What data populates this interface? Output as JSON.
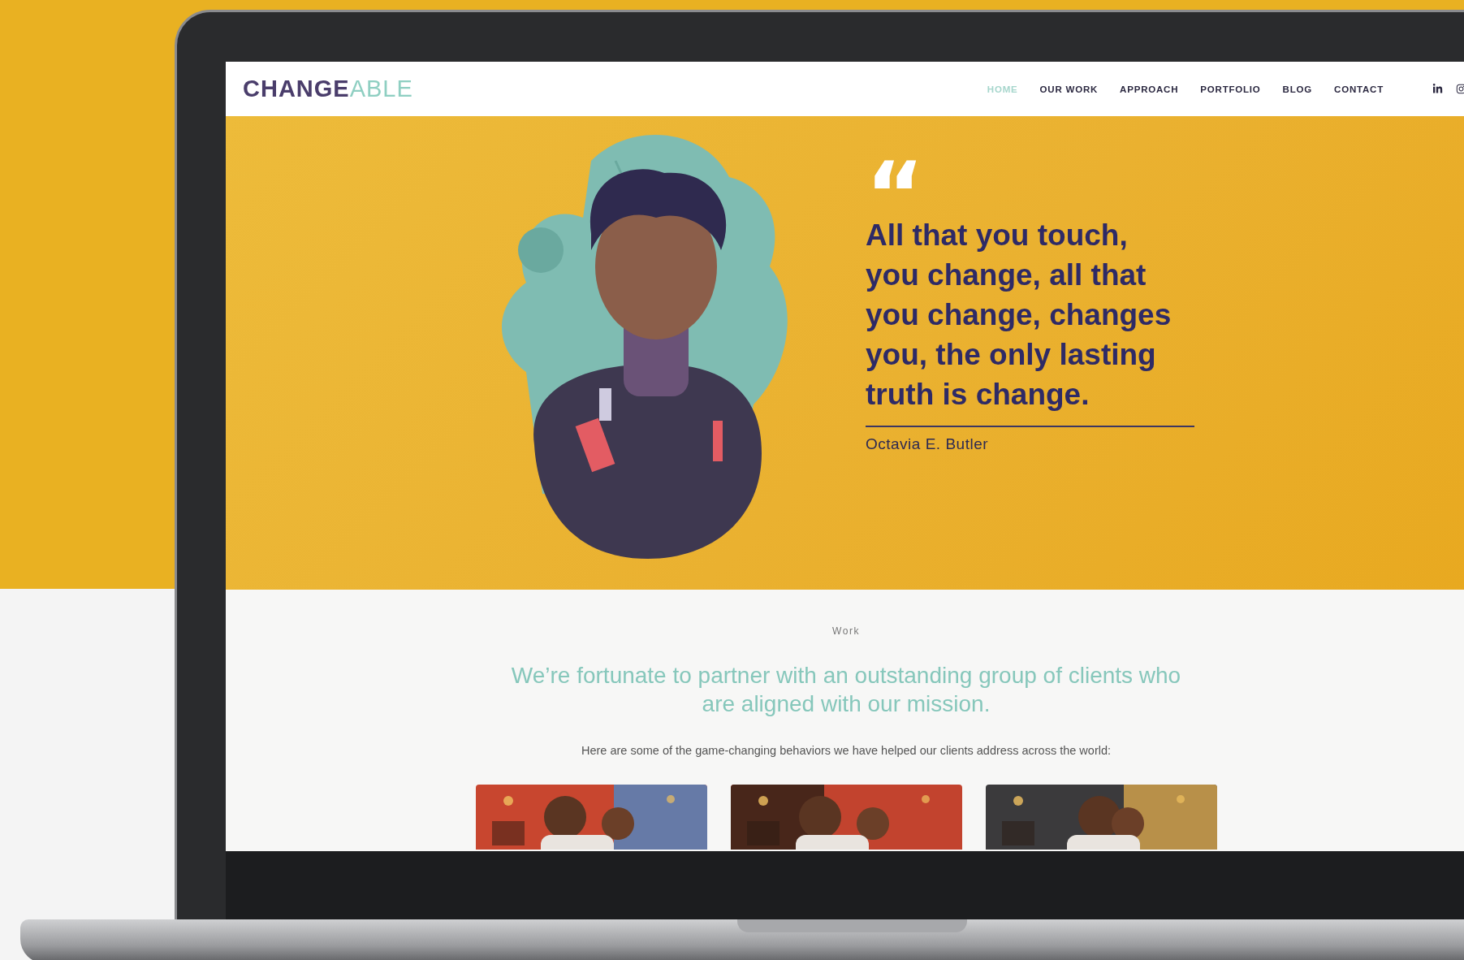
{
  "site": {
    "logo": {
      "first": "CHANGE",
      "second": "ABLE"
    },
    "nav": [
      {
        "label": "HOME",
        "selected": true
      },
      {
        "label": "OUR WORK",
        "selected": false
      },
      {
        "label": "APPROACH",
        "selected": false
      },
      {
        "label": "PORTFOLIO",
        "selected": false
      },
      {
        "label": "BLOG",
        "selected": false
      },
      {
        "label": "CONTACT",
        "selected": false
      }
    ],
    "hero": {
      "quote_mark": "“",
      "quote": "All that you touch, you change, all that you change, changes you, the only lasting truth is change.",
      "author": "Octavia E. Butler"
    },
    "work": {
      "eyebrow": "Work",
      "headline": "We’re fortunate to partner with an outstanding group of clients who are aligned with our mission.",
      "intro": "Here are some of the game-changing behaviors we have helped our clients address across the world:"
    }
  }
}
